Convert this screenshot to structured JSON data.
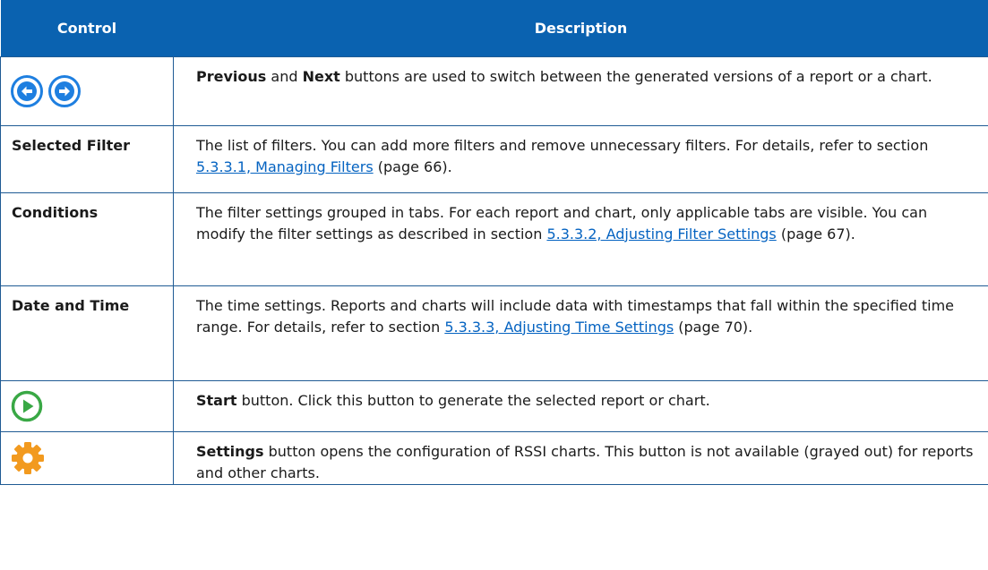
{
  "header": {
    "control": "Control",
    "description": "Description"
  },
  "icons": {
    "nav_prev": "arrow-left-circle-icon",
    "nav_next": "arrow-right-circle-icon",
    "start": "play-circle-icon",
    "settings": "gear-icon"
  },
  "colors": {
    "header_bg": "#0a62b0",
    "nav_icon_blue": "#1e7fe0",
    "start_icon_green": "#39a845",
    "settings_icon_orange": "#f29a1f",
    "link": "#0563c1"
  },
  "rows": [
    {
      "bold": "Previous",
      "t1": " and ",
      "bold2": "Next",
      "t2": " buttons are used to switch between the generated versions of a report or a chart."
    },
    {
      "control": "Selected Filter",
      "t1": "The list of filters. You can add more filters and remove unnecessary filters. For details, refer to section ",
      "link": "5.3.3.1, Managing Filters",
      "t2": " (page 66)."
    },
    {
      "control": "Conditions",
      "t1": "The filter settings grouped in tabs. For each report and chart, only applicable tabs are visible. You can modify the filter settings as described in section ",
      "link": "5.3.3.2, Adjusting Filter Settings",
      "t2": " (page 67)."
    },
    {
      "control": "Date and Time",
      "t1": "The time settings. Reports and charts will include data with timestamps that fall within the specified time range. For details, refer to section ",
      "link": "5.3.3.3, Adjusting Time Settings",
      "t2": " (page 70)."
    },
    {
      "bold": "Start",
      "t1": " button. Click this button to generate the selected report or chart."
    },
    {
      "bold": "Settings",
      "t1": " button opens the configuration of RSSI charts. This button is not available (grayed out) for reports and other charts."
    }
  ]
}
